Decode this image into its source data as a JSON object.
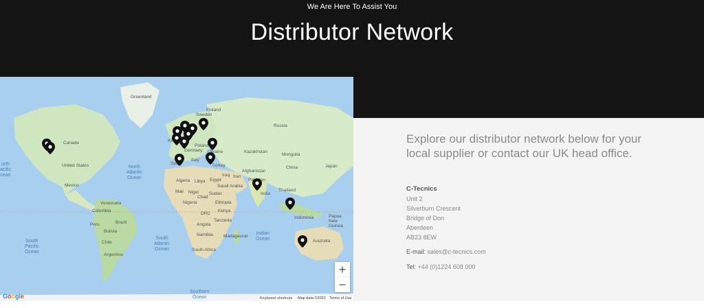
{
  "hero": {
    "subtitle": "We Are Here To Assist You",
    "title": "Distributor Network"
  },
  "map": {
    "labels": {
      "greenland": "Greenland",
      "canada": "Canada",
      "united_states": "United States",
      "mexico": "Mexico",
      "venezuela": "Venezuela",
      "colombia": "Colombia",
      "peru": "Peru",
      "brazil": "Brazil",
      "bolivia": "Bolivia",
      "chile": "Chile",
      "argentina": "Argentina",
      "sweden": "Sweden",
      "finland": "Finland",
      "russia": "Russia",
      "poland": "Poland",
      "germany": "Germany",
      "kingdom": "Kin",
      "ukraine": "Ukraine",
      "italy": "Italy",
      "spain": "Spain",
      "turkey": "Turkey",
      "kazakhstan": "Kazakhstan",
      "mongolia": "Mongolia",
      "china": "China",
      "japan": "Japan",
      "afghanistan": "Afghanistan",
      "iran": "Iran",
      "iraq": "Iraq",
      "pakistan": "Pakistan",
      "india": "India",
      "thailand": "Thailand",
      "algeria": "Algeria",
      "libya": "Libya",
      "egypt": "Egypt",
      "saudi_arabia": "Saudi Arabia",
      "mali": "Mali",
      "niger": "Niger",
      "chad": "Chad",
      "sudan": "Sudan",
      "nigeria": "Nigeria",
      "ethiopia": "Ethiopia",
      "drc": "DRC",
      "kenya": "Kenya",
      "tanzania": "Tanzania",
      "angola": "Angola",
      "namibia": "Namibia",
      "madagascar": "Madagascar",
      "south_africa": "South Africa",
      "indonesia": "Indonesia",
      "papua": "Papua New Guinea",
      "australia": "Australia"
    },
    "oceans": {
      "north_pacific": "orth\nacific\ncean",
      "north_atlantic": "North\nAtlantic\nOcean",
      "south_pacific": "South\nPacific\nOcean",
      "south_atlantic": "South\nAtlantic\nOcean",
      "indian": "Indian\nOcean",
      "southern": "Southern\nOcean"
    },
    "zoom_in": "+",
    "zoom_out": "−",
    "google": "Google",
    "keyboard_shortcuts": "Keyboard shortcuts",
    "map_data": "Map data ©2022",
    "terms": "Terms of Use"
  },
  "info": {
    "intro": "Explore our distributor network below for your local supplier or contact our UK head office.",
    "company": "C-Tecnics",
    "address": [
      "Unit 2",
      "Silverburn Crescent",
      "Bridge of Don",
      "Aberdeen",
      "AB23 8EW"
    ],
    "email_label": "E-mail:",
    "email": "sales@c-tecnics.com",
    "tel_label": "Tel:",
    "tel": "+44 (0)1224 608 000"
  },
  "colors": {
    "hero_bg": "#141414",
    "ocean": "#a9cfee",
    "land": "#cfe6c0",
    "panel_bg": "#f4f4f4"
  }
}
